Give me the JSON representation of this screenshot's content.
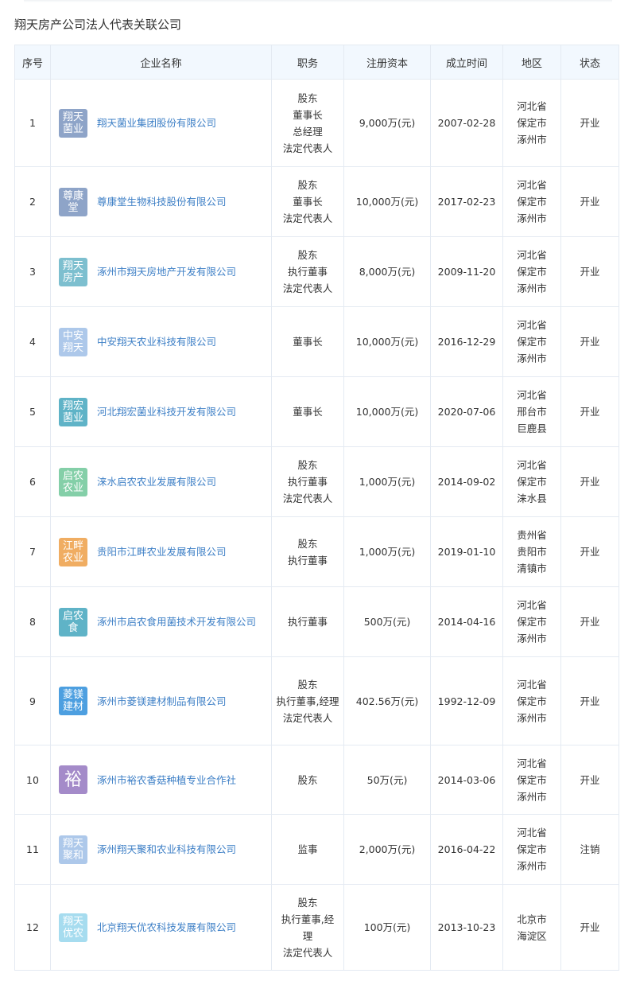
{
  "page": {
    "title": "翔天房产公司法人代表关联公司"
  },
  "table": {
    "headers": [
      "序号",
      "企业名称",
      "职务",
      "注册资本",
      "成立时间",
      "地区",
      "状态"
    ],
    "rows": [
      {
        "index": "1",
        "logo_text": "翔天菌业",
        "logo_color": "#8ea4c8",
        "name": "翔天菌业集团股份有限公司",
        "roles": [
          "股东",
          "董事长",
          "总经理",
          "法定代表人"
        ],
        "capital": "9,000万(元)",
        "founded": "2007-02-28",
        "region": [
          "河北省",
          "保定市",
          "涿州市"
        ],
        "status": "开业",
        "status_type": "open"
      },
      {
        "index": "2",
        "logo_text": "尊康堂",
        "logo_color": "#8ea4c8",
        "name": "尊康堂生物科技股份有限公司",
        "roles": [
          "股东",
          "董事长",
          "法定代表人"
        ],
        "capital": "10,000万(元)",
        "founded": "2017-02-23",
        "region": [
          "河北省",
          "保定市",
          "涿州市"
        ],
        "status": "开业",
        "status_type": "open"
      },
      {
        "index": "3",
        "logo_text": "翔天房产",
        "logo_color": "#7dbfcf",
        "name": "涿州市翔天房地产开发有限公司",
        "roles": [
          "股东",
          "执行董事",
          "法定代表人"
        ],
        "capital": "8,000万(元)",
        "founded": "2009-11-20",
        "region": [
          "河北省",
          "保定市",
          "涿州市"
        ],
        "status": "开业",
        "status_type": "open"
      },
      {
        "index": "4",
        "logo_text": "中安翔天",
        "logo_color": "#adc8ea",
        "name": "中安翔天农业科技有限公司",
        "roles": [
          "董事长"
        ],
        "capital": "10,000万(元)",
        "founded": "2016-12-29",
        "region": [
          "河北省",
          "保定市",
          "涿州市"
        ],
        "status": "开业",
        "status_type": "open"
      },
      {
        "index": "5",
        "logo_text": "翔宏菌业",
        "logo_color": "#5fb3c7",
        "name": "河北翔宏菌业科技开发有限公司",
        "roles": [
          "董事长"
        ],
        "capital": "10,000万(元)",
        "founded": "2020-07-06",
        "region": [
          "河北省",
          "邢台市",
          "巨鹿县"
        ],
        "status": "开业",
        "status_type": "open"
      },
      {
        "index": "6",
        "logo_text": "启农农业",
        "logo_color": "#84cfa8",
        "name": "涞水启农农业发展有限公司",
        "roles": [
          "股东",
          "执行董事",
          "法定代表人"
        ],
        "capital": "1,000万(元)",
        "founded": "2014-09-02",
        "region": [
          "河北省",
          "保定市",
          "涞水县"
        ],
        "status": "开业",
        "status_type": "open"
      },
      {
        "index": "7",
        "logo_text": "江畔农业",
        "logo_color": "#f0ad62",
        "name": "贵阳市江畔农业发展有限公司",
        "roles": [
          "股东",
          "执行董事"
        ],
        "capital": "1,000万(元)",
        "founded": "2019-01-10",
        "region": [
          "贵州省",
          "贵阳市",
          "清镇市"
        ],
        "status": "开业",
        "status_type": "open"
      },
      {
        "index": "8",
        "logo_text": "启农食",
        "logo_color": "#5fb3c7",
        "name": "涿州市启农食用菌技术开发有限公司",
        "roles": [
          "执行董事"
        ],
        "capital": "500万(元)",
        "founded": "2014-04-16",
        "region": [
          "河北省",
          "保定市",
          "涿州市"
        ],
        "status": "开业",
        "status_type": "open"
      },
      {
        "index": "9",
        "logo_text": "菱镁建材",
        "logo_color": "#4d9fe0",
        "name": "涿州市菱镁建材制品有限公司",
        "roles": [
          "股东",
          "执行董事,经理",
          "法定代表人"
        ],
        "capital": "402.56万(元)",
        "founded": "1992-12-09",
        "region": [
          "河北省",
          "保定市",
          "涿州市"
        ],
        "status": "开业",
        "status_type": "open"
      },
      {
        "index": "10",
        "logo_text": "裕",
        "logo_color": "#a48bc9",
        "name": "涿州市裕农香菇种植专业合作社",
        "roles": [
          "股东"
        ],
        "capital": "50万(元)",
        "founded": "2014-03-06",
        "region": [
          "河北省",
          "保定市",
          "涿州市"
        ],
        "status": "开业",
        "status_type": "open"
      },
      {
        "index": "11",
        "logo_text": "翔天聚和",
        "logo_color": "#adc8ea",
        "name": "涿州翔天聚和农业科技有限公司",
        "roles": [
          "监事"
        ],
        "capital": "2,000万(元)",
        "founded": "2016-04-22",
        "region": [
          "河北省",
          "保定市",
          "涿州市"
        ],
        "status": "注销",
        "status_type": "closed"
      },
      {
        "index": "12",
        "logo_text": "翔天优农",
        "logo_color": "#a6dcef",
        "name": "北京翔天优农科技发展有限公司",
        "roles": [
          "股东",
          "执行董事,经",
          "理",
          "法定代表人"
        ],
        "capital": "100万(元)",
        "founded": "2013-10-23",
        "region": [
          "北京市",
          "海淀区"
        ],
        "status": "开业",
        "status_type": "open"
      }
    ]
  }
}
